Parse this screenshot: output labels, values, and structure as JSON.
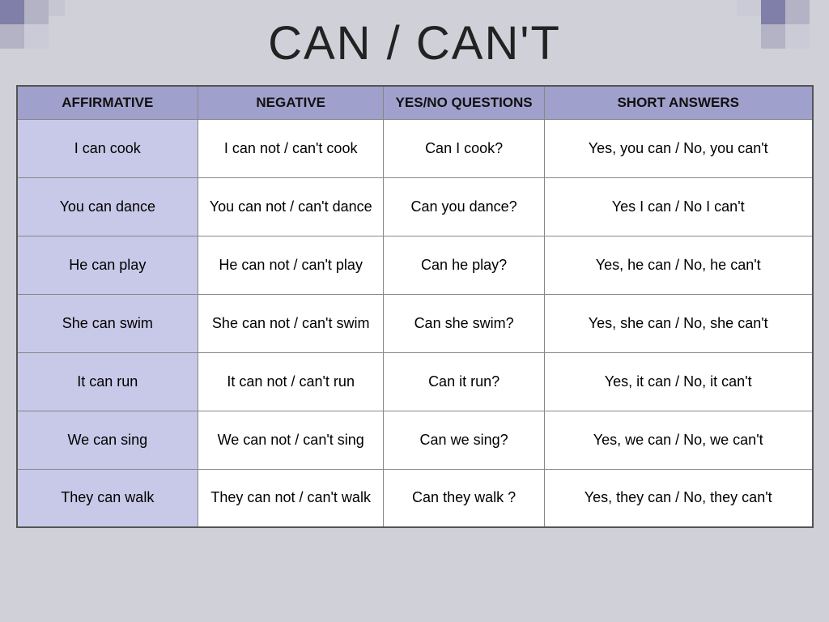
{
  "title": "CAN / CAN'T",
  "table": {
    "headers": [
      "AFFIRMATIVE",
      "NEGATIVE",
      "YES/NO QUESTIONS",
      "SHORT ANSWERS"
    ],
    "rows": [
      {
        "affirmative": "I can cook",
        "negative": "I can not  / can't cook",
        "question": "Can I cook?",
        "short_answer": "Yes, you can / No, you can't"
      },
      {
        "affirmative": "You can dance",
        "negative": "You can not / can't dance",
        "question": "Can you dance?",
        "short_answer": "Yes I can /  No I can't"
      },
      {
        "affirmative": "He can play",
        "negative": "He can not / can't play",
        "question": "Can he play?",
        "short_answer": "Yes, he can / No, he can't"
      },
      {
        "affirmative": "She can swim",
        "negative": "She can not / can't swim",
        "question": "Can she swim?",
        "short_answer": "Yes, she can / No, she can't"
      },
      {
        "affirmative": "It can  run",
        "negative": "It can not / can't run",
        "question": "Can it run?",
        "short_answer": "Yes, it can / No, it can't"
      },
      {
        "affirmative": "We can sing",
        "negative": "We can not / can't sing",
        "question": "Can we sing?",
        "short_answer": "Yes, we can / No, we can't"
      },
      {
        "affirmative": "They can walk",
        "negative": "They can not / can't walk",
        "question": "Can they walk ?",
        "short_answer": "Yes, they can / No, they can't"
      }
    ]
  }
}
